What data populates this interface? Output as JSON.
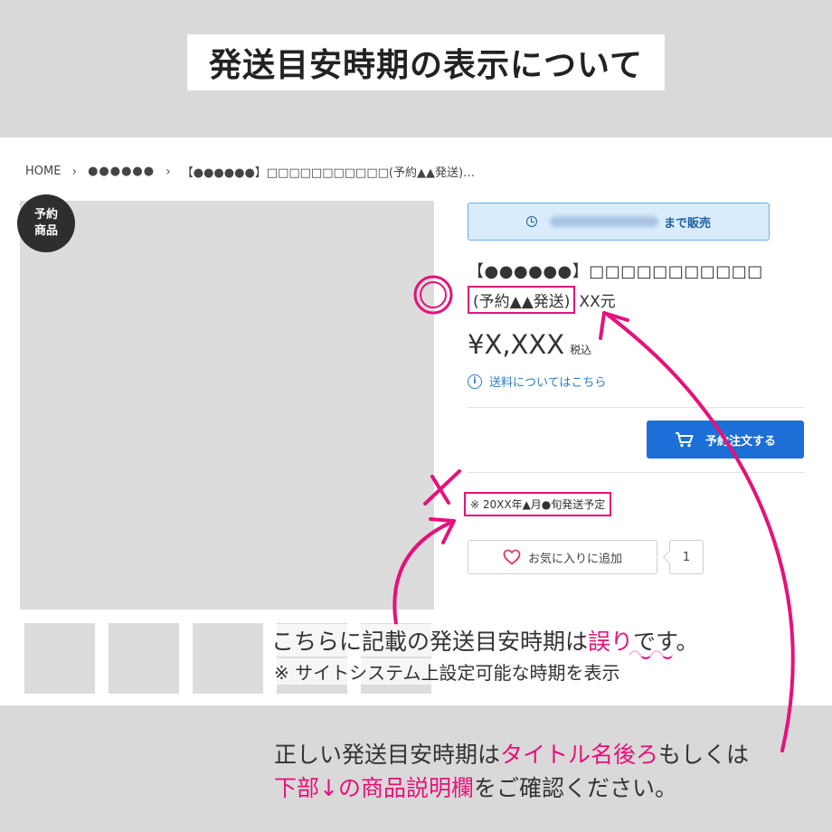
{
  "header": {
    "title": "発送目安時期の表示について"
  },
  "breadcrumb": {
    "home": "HOME",
    "sep": "›",
    "category": "●●●●●●",
    "current": "【●●●●●●】□□□□□□□□□□□(予約▲▲発送)…"
  },
  "badge": {
    "label": "予約\n商品"
  },
  "sale_banner": {
    "label": "まで販売",
    "icon": "clock-icon"
  },
  "product": {
    "title_line1": "【●●●●●●】□□□□□□□□□□□",
    "title_reserve": "(予約▲▲発送)",
    "title_suffix": "XX元",
    "price": "¥X,XXX",
    "tax": "税込",
    "shipping_link": "送料についてはこちら",
    "info_icon": "i"
  },
  "order_button": {
    "label": "予約注文する",
    "icon": "cart-icon"
  },
  "ship_note": "※ 20XX年▲月●旬発送予定",
  "favorite": {
    "label": "お気に入りに追加",
    "count": "1",
    "icon": "heart-icon"
  },
  "annotations": {
    "caption1_pre": "こちらに記載の発送目安時期は",
    "caption1_em": "誤り",
    "caption1_post": "です。",
    "caption2": "※ サイトシステム上設定可能な時期を表示",
    "bottom1_pre": "正しい発送目安時期は",
    "bottom1_em": "タイトル名後ろ",
    "bottom1_post": "もしくは",
    "bottom2_em": "下部↓の商品説明欄",
    "bottom2_post": "をご確認ください。",
    "correct_mark": "circle-mark",
    "wrong_mark": "cross-mark"
  },
  "colors": {
    "accent": "#e6117a",
    "primary": "#1b6fd6",
    "link": "#2a7cc7"
  }
}
